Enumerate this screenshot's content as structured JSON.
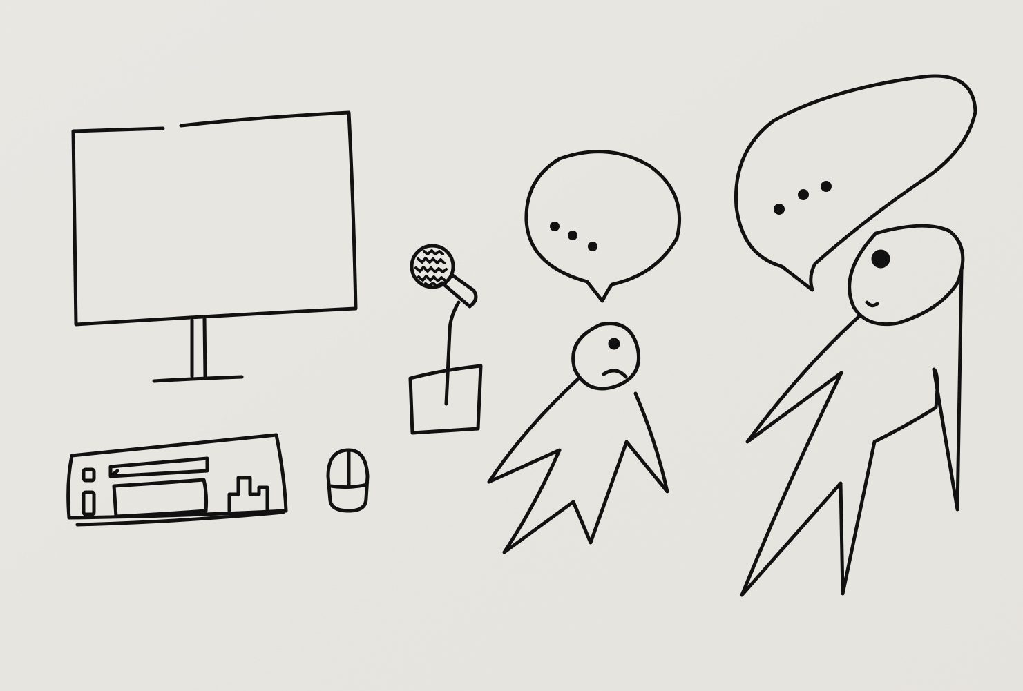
{
  "scene": {
    "paper_color": "#e9e7e2",
    "ink_color": "#111111",
    "speech_bubbles": [
      {
        "content": "...",
        "dot_count": 3
      },
      {
        "content": "...",
        "dot_count": 3
      }
    ]
  }
}
